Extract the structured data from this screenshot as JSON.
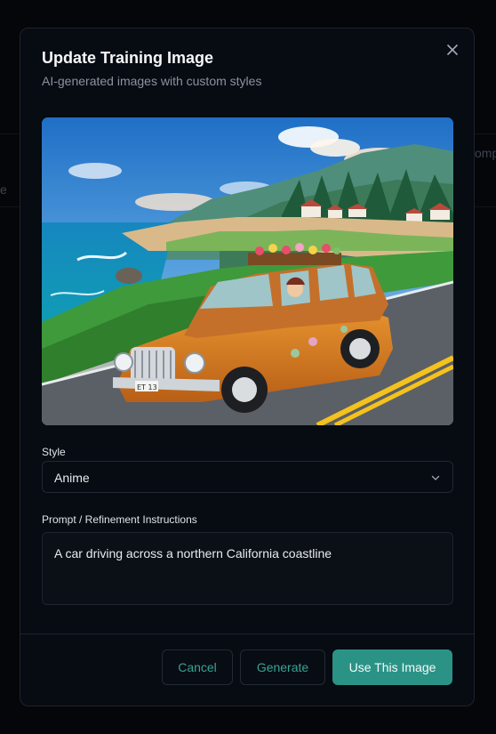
{
  "dialog": {
    "title": "Update Training Image",
    "subtitle": "AI-generated images with custom styles",
    "close_icon": "close-icon"
  },
  "background": {
    "left_fragment": "e",
    "right_fragment": "omp"
  },
  "preview": {
    "image_kind": "anime-style illustration of an orange woodie station wagon driving along a coastal road",
    "plate_text": "ET 13"
  },
  "style_field": {
    "label": "Style",
    "value": "Anime",
    "chevron_icon": "chevron-down-icon"
  },
  "prompt_field": {
    "label": "Prompt / Refinement Instructions",
    "value": "A car driving across a northern California coastline"
  },
  "footer": {
    "cancel_label": "Cancel",
    "generate_label": "Generate",
    "use_label": "Use This Image"
  },
  "colors": {
    "accent": "#2b9386",
    "accent_text": "#38a394",
    "modal_bg": "#070b12",
    "border": "#1d232e"
  }
}
